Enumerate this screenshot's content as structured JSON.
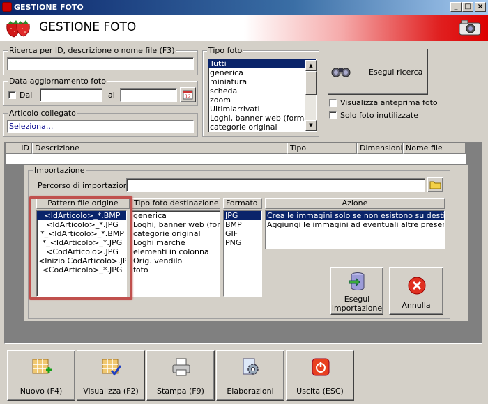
{
  "window": {
    "title": "GESTIONE FOTO",
    "min": "_",
    "max": "□",
    "close": "×"
  },
  "header": {
    "title": "GESTIONE FOTO"
  },
  "search": {
    "legend": "Ricerca per ID, descrizione o nome file (F3)",
    "value": ""
  },
  "date": {
    "legend": "Data aggiornamento foto",
    "from_label": "Dal",
    "to_label": "al",
    "from_value": "",
    "to_value": ""
  },
  "article": {
    "legend": "Articolo collegato",
    "value": "Seleziona..."
  },
  "photo_type": {
    "legend": "Tipo foto",
    "items": [
      "Tutti",
      "generica",
      "miniatura",
      "scheda",
      "zoom",
      "Ultimiarrivati",
      "Loghi, banner web (formato",
      "categorie original"
    ],
    "selected": 0
  },
  "search_button": {
    "label": "Esegui ricerca"
  },
  "options": {
    "preview": "Visualizza anteprima foto",
    "unused": "Solo foto inutilizzate"
  },
  "grid": {
    "columns": [
      "ID",
      "Descrizione",
      "Tipo",
      "Dimensioni",
      "Nome file"
    ]
  },
  "import": {
    "legend": "Importazione",
    "path_label": "Percorso di importazione :",
    "path_value": "",
    "pattern_header": "Pattern file origine",
    "patterns": [
      "<IdArticolo>_*.BMP",
      "<IdArticolo>_*.JPG",
      "*_<IdArticolo>_*.BMP",
      "*_<IdArticolo>_*.JPG",
      "<CodArticolo>.JPG",
      "<Inizio CodArticolo>.JPG",
      "<CodArticolo>_*.JPG"
    ],
    "dest_header": "Tipo foto destinazione",
    "dest_types": [
      "generica",
      "Loghi, banner web (format",
      "categorie original",
      "Loghi marche",
      "elementi in colonna",
      "Orig. vendilo",
      "foto"
    ],
    "format_header": "Formato",
    "formats": [
      "JPG",
      "BMP",
      "GIF",
      "PNG"
    ],
    "action_header": "Azione",
    "actions": [
      "Crea le immagini solo se non esistono su destinazione",
      "Aggiungi le immagini ad eventuali altre presenti su de"
    ],
    "run_label_1": "Esegui",
    "run_label_2": "importazione",
    "cancel_label": "Annulla"
  },
  "toolbar": {
    "new": "Nuovo (F4)",
    "view": "Visualizza (F2)",
    "print": "Stampa (F9)",
    "process": "Elaborazioni",
    "exit": "Uscita (ESC)"
  },
  "colors": {
    "selection": "#0a246a",
    "highlight_box": "#c0504d",
    "link_text": "#00008b"
  }
}
